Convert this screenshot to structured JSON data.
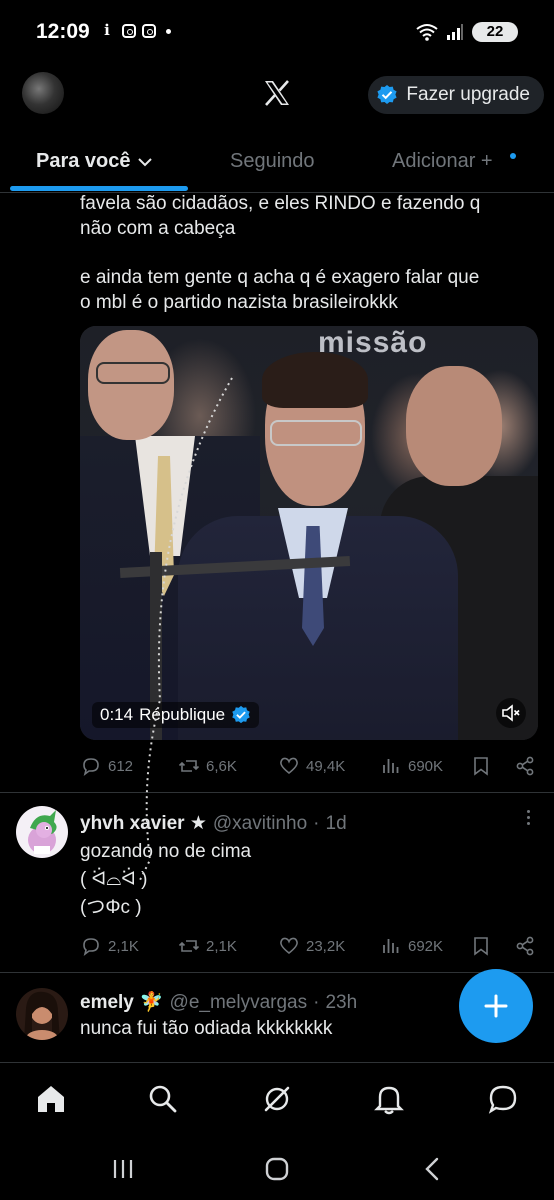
{
  "status_bar": {
    "time": "12:09",
    "battery": "22",
    "icons": [
      "info-icon",
      "instagram-icon",
      "instagram-icon",
      "dot-icon",
      "wifi-icon",
      "signal-icon",
      "battery-icon"
    ]
  },
  "header": {
    "upgrade_label": "Fazer upgrade"
  },
  "tabs": [
    {
      "label": "Para você",
      "active": true
    },
    {
      "label": "Seguindo",
      "active": false
    },
    {
      "label": "Adicionar +",
      "active": false
    }
  ],
  "post": {
    "text_lines_1": "favela são cidadãos, e eles RINDO e fazendo q\nnão com a cabeça",
    "text_lines_2": "e ainda tem gente q acha q é exagero falar que\no mbl é o partido nazista brasileirokkk",
    "media": {
      "time": "0:14",
      "source_label": "République",
      "logo_text": "missão"
    },
    "stats": {
      "replies": "612",
      "reposts": "6,6K",
      "likes": "49,4K",
      "views": "690K"
    }
  },
  "replies": [
    {
      "name": "yhvh xavier ★",
      "handle": "@xavitinho",
      "time": "1d",
      "text": "gozando no de cima\n( ᐛ⌓ᐛ )\n(つΦc )",
      "stats": {
        "replies": "2,1K",
        "reposts": "2,1K",
        "likes": "23,2K",
        "views": "692K"
      }
    },
    {
      "name": "emely",
      "name_emoji": "🧚",
      "handle": "@e_melyvargas",
      "time": "23h",
      "text": "nunca fui tão odiada kkkkkkkk"
    }
  ],
  "colors": {
    "accent": "#1d9bf0",
    "background": "#000000",
    "text": "#e7e9ea",
    "muted": "#71767b"
  }
}
